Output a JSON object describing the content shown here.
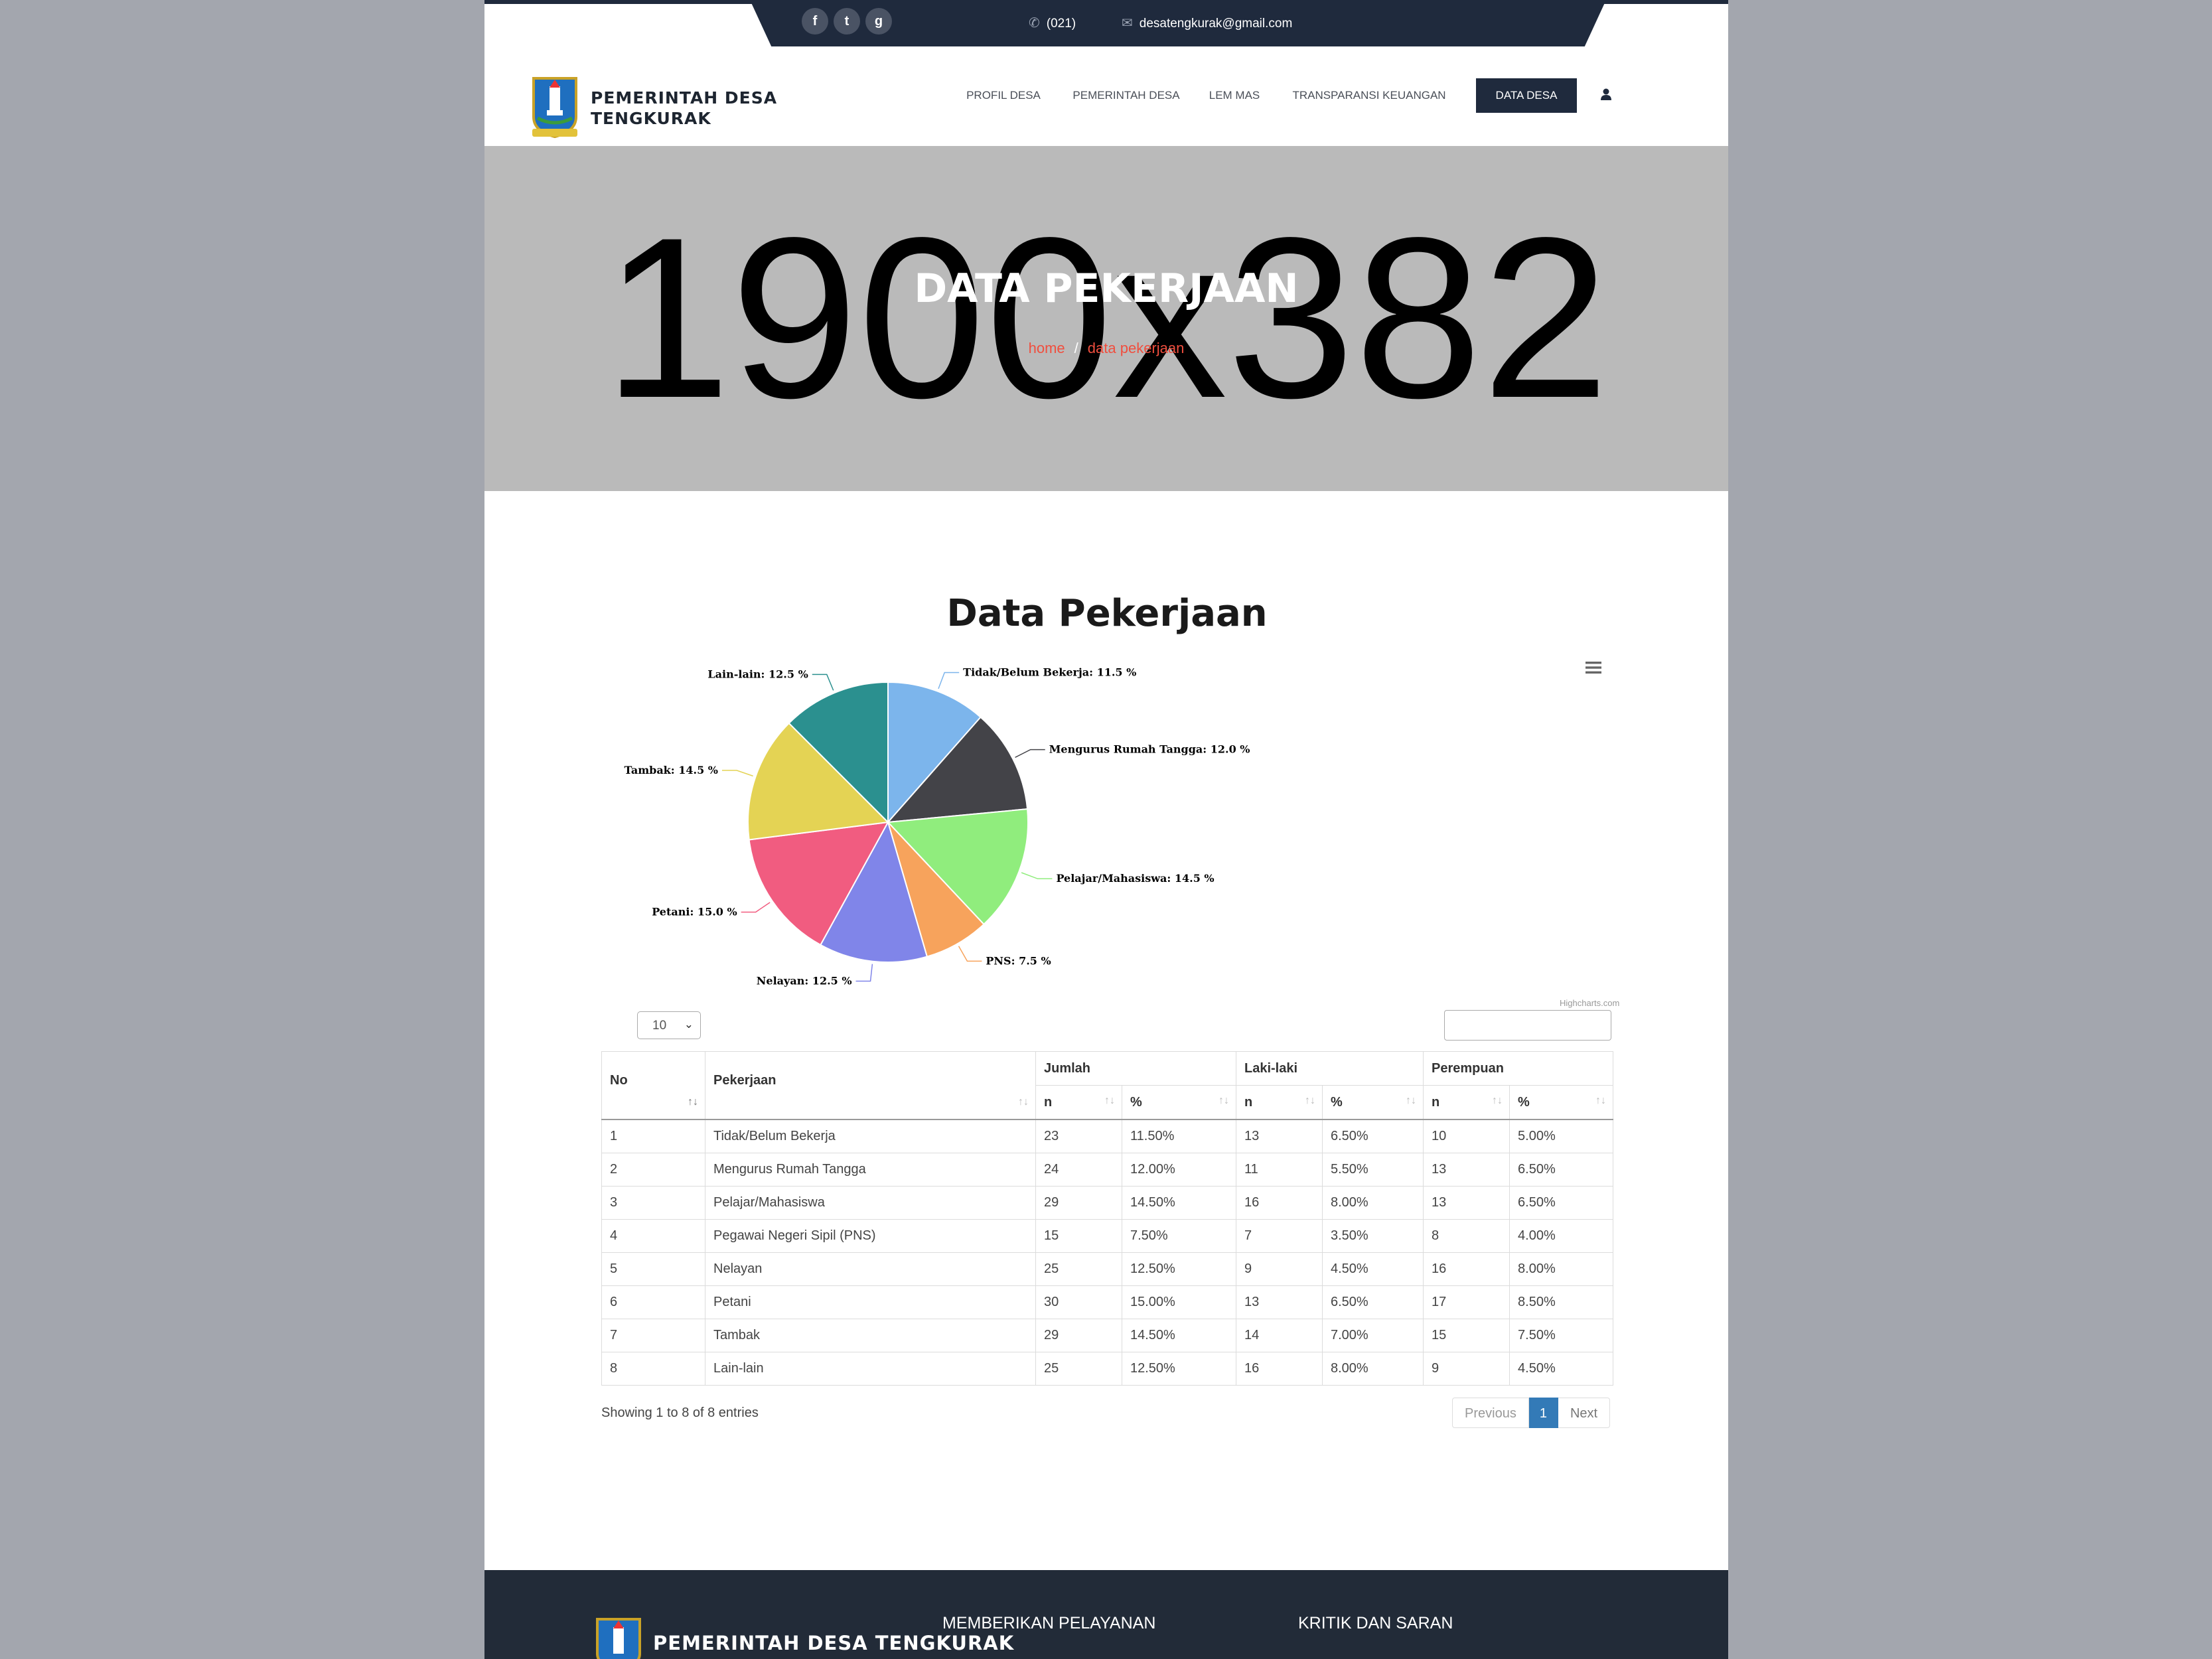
{
  "topbar": {
    "social": [
      {
        "icon": "facebook-icon",
        "glyph": "f"
      },
      {
        "icon": "twitter-icon",
        "glyph": "t"
      },
      {
        "icon": "google-plus-icon",
        "glyph": "g"
      }
    ],
    "phone": "(021)",
    "email": "desatengkurak@gmail.com"
  },
  "header": {
    "brand": "PEMERINTAH DESA TENGKURAK",
    "nav": [
      {
        "label": "PROFIL DESA",
        "active": false
      },
      {
        "label": "PEMERINTAH DESA",
        "active": false
      },
      {
        "label": "LEM MAS",
        "active": false
      },
      {
        "label": "TRANSPARANSI KEUANGAN",
        "active": false
      },
      {
        "label": "DATA DESA",
        "active": true
      }
    ]
  },
  "banner": {
    "placeholder": "1900x382",
    "title": "DATA PEKERJAAN",
    "breadcrumb_home": "home",
    "breadcrumb_sep": "/",
    "breadcrumb_current": "data pekerjaan"
  },
  "chart_data": {
    "type": "pie",
    "title": "Data Pekerjaan",
    "credits": "Highcharts.com",
    "start_angle_deg": 0,
    "slices": [
      {
        "name": "Tidak/Belum Bekerja",
        "value": 11.5,
        "color": "#7cb5ec"
      },
      {
        "name": "Mengurus Rumah Tangga",
        "value": 12.0,
        "color": "#434348"
      },
      {
        "name": "Pelajar/Mahasiswa",
        "value": 14.5,
        "color": "#90ed7d"
      },
      {
        "name": "PNS",
        "value": 7.5,
        "color": "#f7a35c"
      },
      {
        "name": "Nelayan",
        "value": 12.5,
        "color": "#8085e9"
      },
      {
        "name": "Petani",
        "value": 15.0,
        "color": "#f15c80"
      },
      {
        "name": "Tambak",
        "value": 14.5,
        "color": "#e4d354"
      },
      {
        "name": "Lain-lain",
        "value": 12.5,
        "color": "#2b908f"
      }
    ],
    "labels": [
      "Tidak/Belum Bekerja: 11.5 %",
      "Mengurus Rumah Tangga: 12.0 %",
      "Pelajar/Mahasiswa: 14.5 %",
      "PNS: 7.5 %",
      "Nelayan: 12.5 %",
      "Petani: 15.0 %",
      "Tambak: 14.5 %",
      "Lain-lain: 12.5 %"
    ]
  },
  "table": {
    "length_value": "10",
    "headers": {
      "no": "No",
      "pekerjaan": "Pekerjaan",
      "jumlah": "Jumlah",
      "laki": "Laki-laki",
      "perempuan": "Perempuan",
      "n": "n",
      "pct": "%"
    },
    "rows": [
      [
        "1",
        "Tidak/Belum Bekerja",
        "23",
        "11.50%",
        "13",
        "6.50%",
        "10",
        "5.00%"
      ],
      [
        "2",
        "Mengurus Rumah Tangga",
        "24",
        "12.00%",
        "11",
        "5.50%",
        "13",
        "6.50%"
      ],
      [
        "3",
        "Pelajar/Mahasiswa",
        "29",
        "14.50%",
        "16",
        "8.00%",
        "13",
        "6.50%"
      ],
      [
        "4",
        "Pegawai Negeri Sipil (PNS)",
        "15",
        "7.50%",
        "7",
        "3.50%",
        "8",
        "4.00%"
      ],
      [
        "5",
        "Nelayan",
        "25",
        "12.50%",
        "9",
        "4.50%",
        "16",
        "8.00%"
      ],
      [
        "6",
        "Petani",
        "30",
        "15.00%",
        "13",
        "6.50%",
        "17",
        "8.50%"
      ],
      [
        "7",
        "Tambak",
        "29",
        "14.50%",
        "14",
        "7.00%",
        "15",
        "7.50%"
      ],
      [
        "8",
        "Lain-lain",
        "25",
        "12.50%",
        "16",
        "8.00%",
        "9",
        "4.50%"
      ]
    ],
    "info": "Showing 1 to 8 of 8 entries",
    "pager": {
      "previous": "Previous",
      "current": "1",
      "next": "Next"
    }
  },
  "footer": {
    "brand": "PEMERINTAH DESA TENGKURAK",
    "col2_title": "MEMBERIKAN PELAYANAN",
    "col3_title": "KRITIK DAN SARAN"
  }
}
